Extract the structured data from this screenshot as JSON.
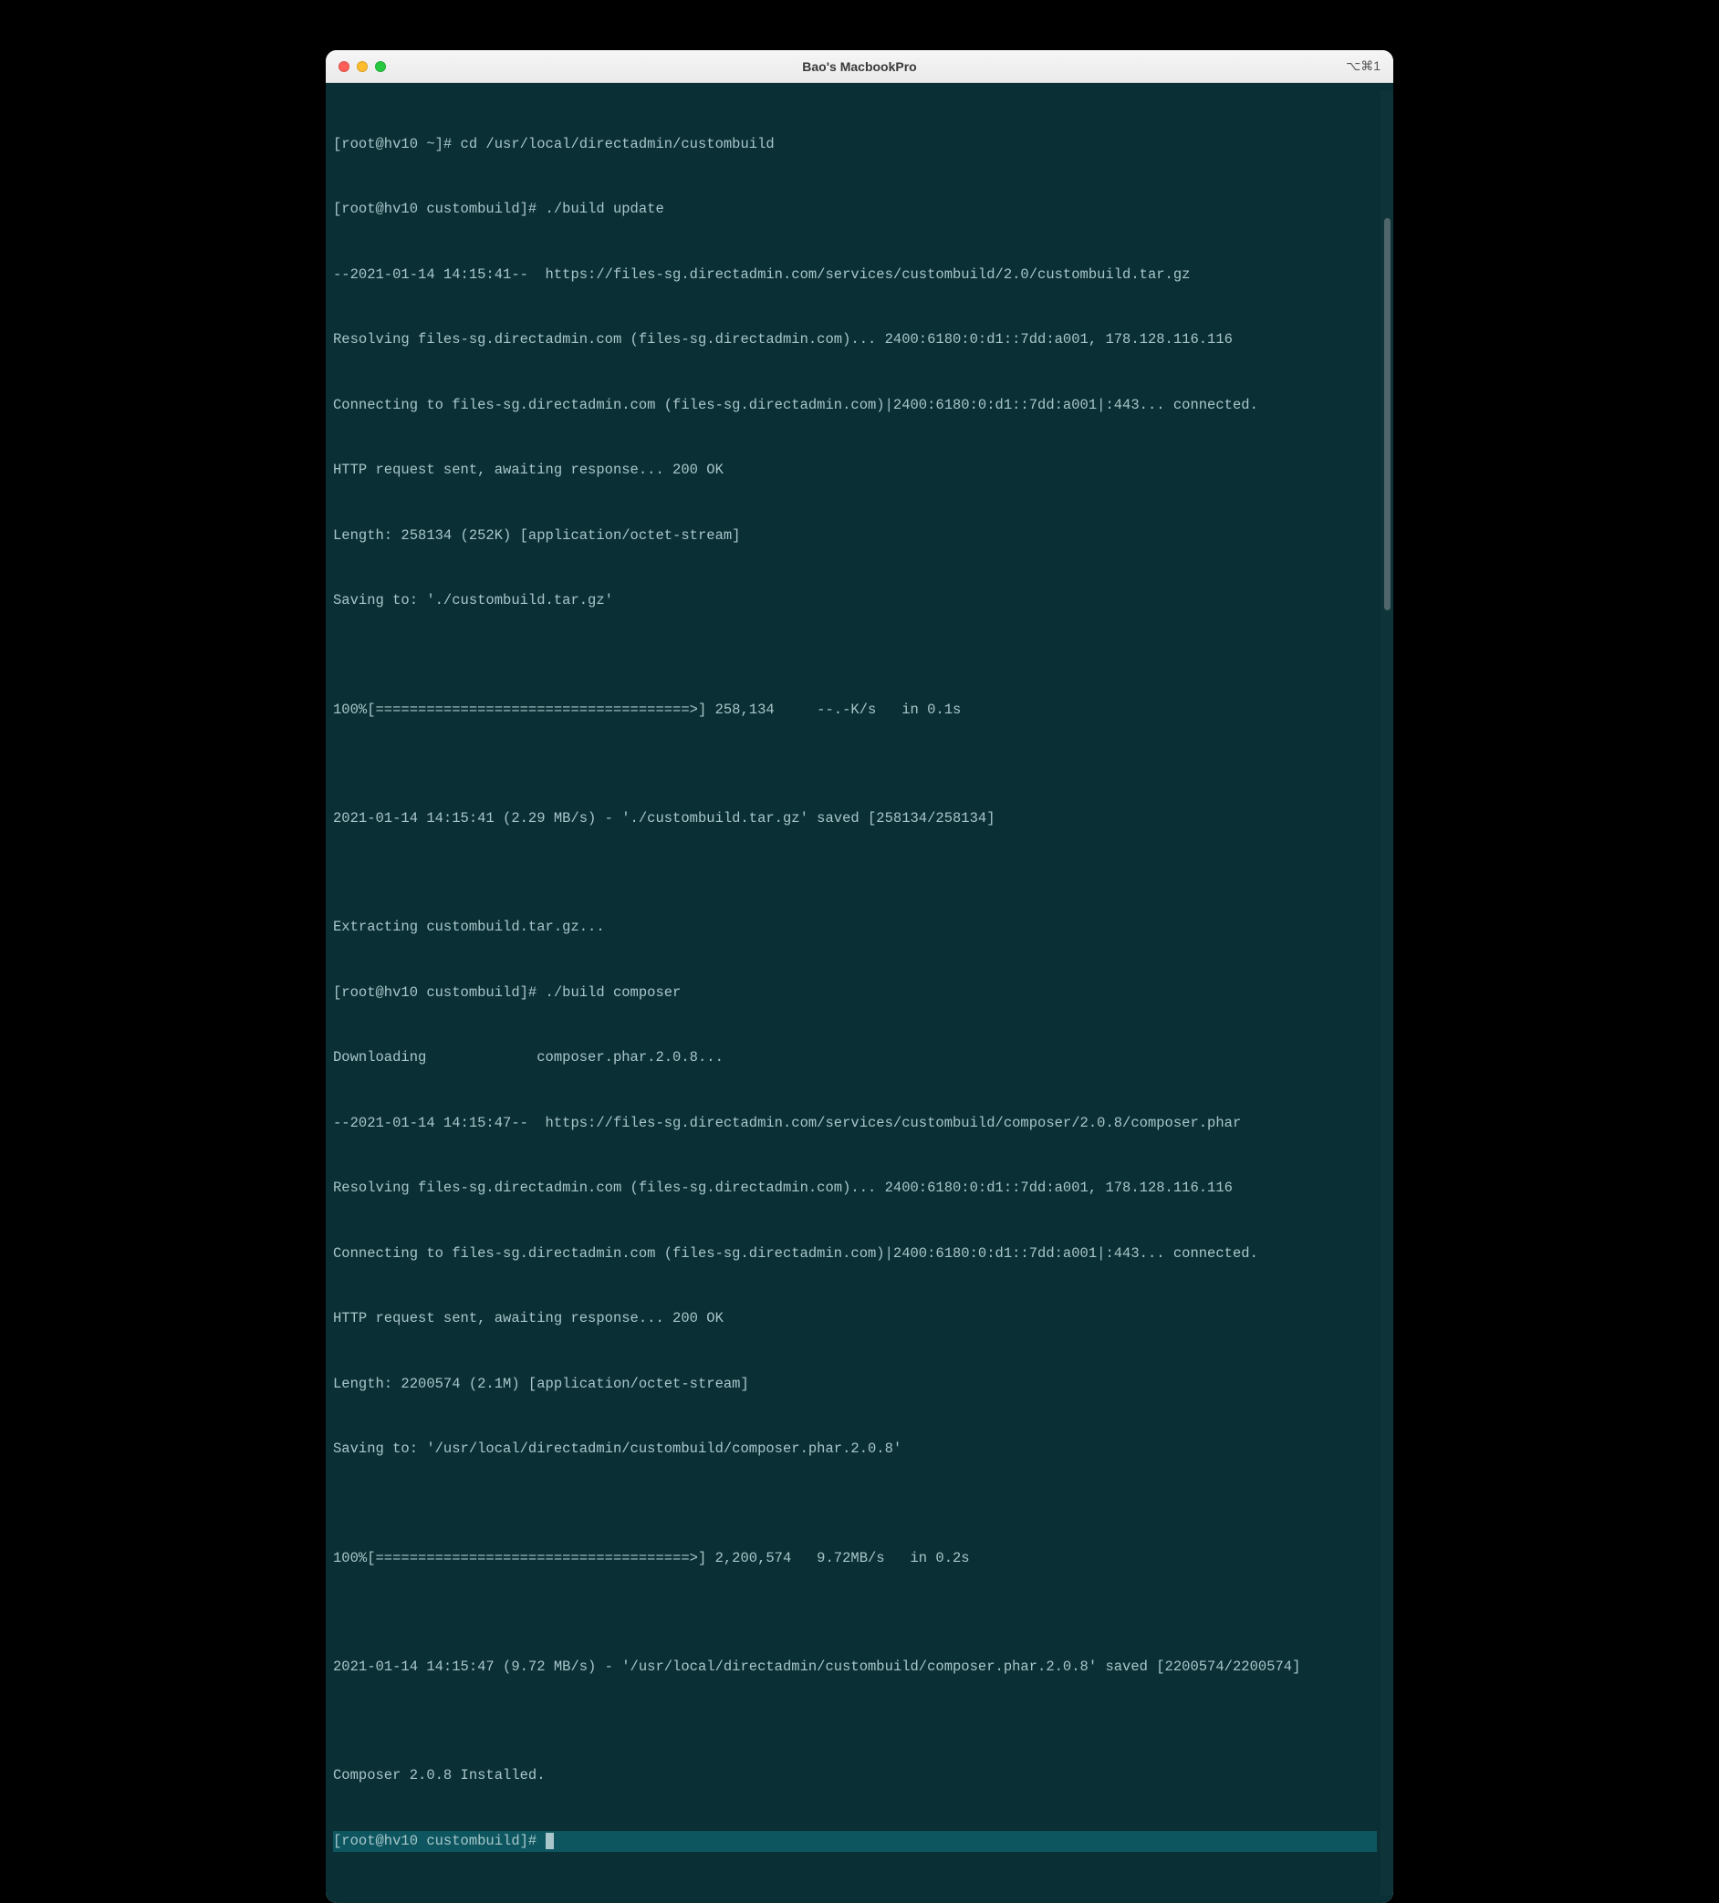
{
  "window": {
    "title": "Bao's MacbookPro",
    "shortcut": "⌥⌘1"
  },
  "terminal": {
    "lines": [
      "[root@hv10 ~]# cd /usr/local/directadmin/custombuild",
      "[root@hv10 custombuild]# ./build update",
      "--2021-01-14 14:15:41--  https://files-sg.directadmin.com/services/custombuild/2.0/custombuild.tar.gz",
      "Resolving files-sg.directadmin.com (files-sg.directadmin.com)... 2400:6180:0:d1::7dd:a001, 178.128.116.116",
      "Connecting to files-sg.directadmin.com (files-sg.directadmin.com)|2400:6180:0:d1::7dd:a001|:443... connected.",
      "HTTP request sent, awaiting response... 200 OK",
      "Length: 258134 (252K) [application/octet-stream]",
      "Saving to: './custombuild.tar.gz'",
      "",
      "100%[=====================================>] 258,134     --.-K/s   in 0.1s",
      "",
      "2021-01-14 14:15:41 (2.29 MB/s) - './custombuild.tar.gz' saved [258134/258134]",
      "",
      "Extracting custombuild.tar.gz...",
      "[root@hv10 custombuild]# ./build composer",
      "Downloading             composer.phar.2.0.8...",
      "--2021-01-14 14:15:47--  https://files-sg.directadmin.com/services/custombuild/composer/2.0.8/composer.phar",
      "Resolving files-sg.directadmin.com (files-sg.directadmin.com)... 2400:6180:0:d1::7dd:a001, 178.128.116.116",
      "Connecting to files-sg.directadmin.com (files-sg.directadmin.com)|2400:6180:0:d1::7dd:a001|:443... connected.",
      "HTTP request sent, awaiting response... 200 OK",
      "Length: 2200574 (2.1M) [application/octet-stream]",
      "Saving to: '/usr/local/directadmin/custombuild/composer.phar.2.0.8'",
      "",
      "100%[=====================================>] 2,200,574   9.72MB/s   in 0.2s",
      "",
      "2021-01-14 14:15:47 (9.72 MB/s) - '/usr/local/directadmin/custombuild/composer.phar.2.0.8' saved [2200574/2200574]",
      "",
      "Composer 2.0.8 Installed."
    ],
    "prompt": "[root@hv10 custombuild]# "
  }
}
